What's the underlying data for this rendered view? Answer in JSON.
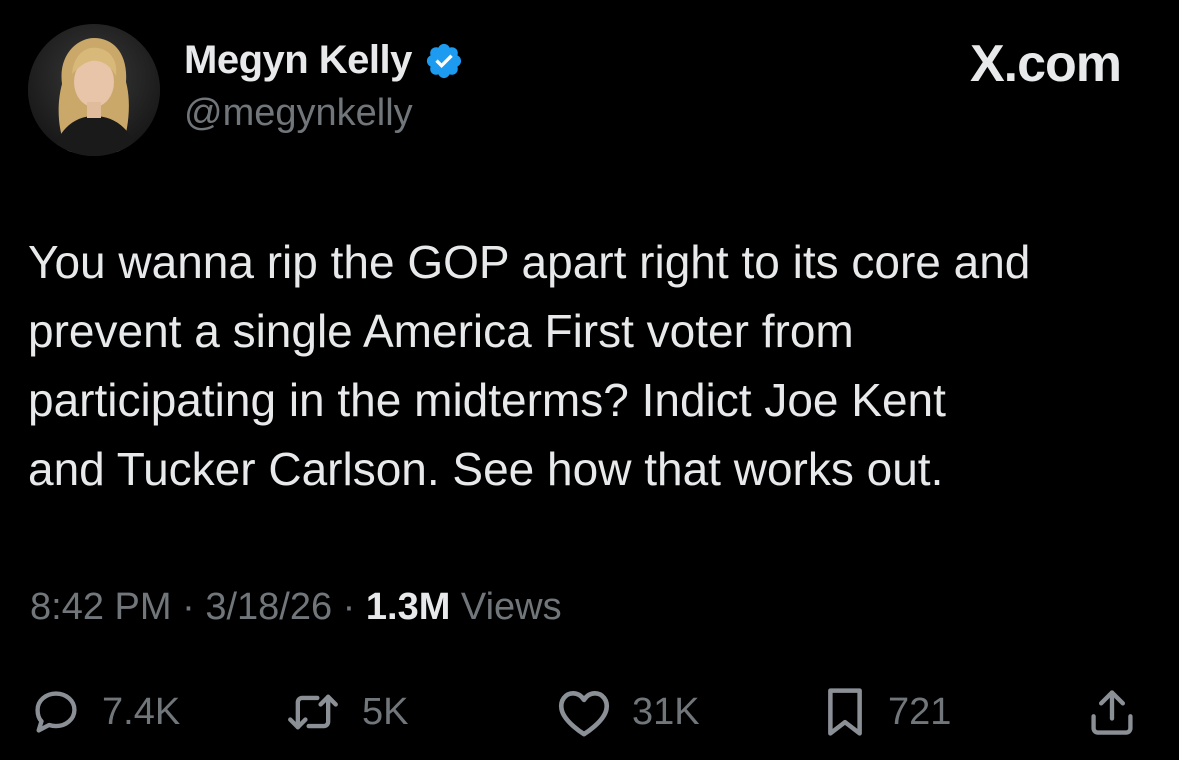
{
  "author": {
    "display_name": "Megyn Kelly",
    "handle": "@megynkelly",
    "verified_icon": "verified-badge-icon",
    "verified_color": "#1d9bf0"
  },
  "brand": "X.com",
  "tweet": {
    "lines": [
      "You wanna rip the GOP apart right to its core and",
      "prevent a single America First voter from",
      "participating in the midterms? Indict Joe Kent",
      "and Tucker Carlson. See how that works out."
    ]
  },
  "meta": {
    "time": "8:42 PM",
    "sep1": " · ",
    "date": "3/18/26",
    "sep2": " · ",
    "views_count": "1.3M",
    "views_label": " Views"
  },
  "actions": {
    "reply": {
      "icon": "reply-icon",
      "count": "7.4K"
    },
    "repost": {
      "icon": "repost-icon",
      "count": "5K"
    },
    "like": {
      "icon": "heart-icon",
      "count": "31K"
    },
    "bookmark": {
      "icon": "bookmark-icon",
      "count": "721"
    },
    "share": {
      "icon": "share-icon"
    }
  },
  "colors": {
    "background": "#000000",
    "primary_text": "#e7e9ea",
    "secondary_text": "#71767b",
    "accent": "#1d9bf0"
  }
}
